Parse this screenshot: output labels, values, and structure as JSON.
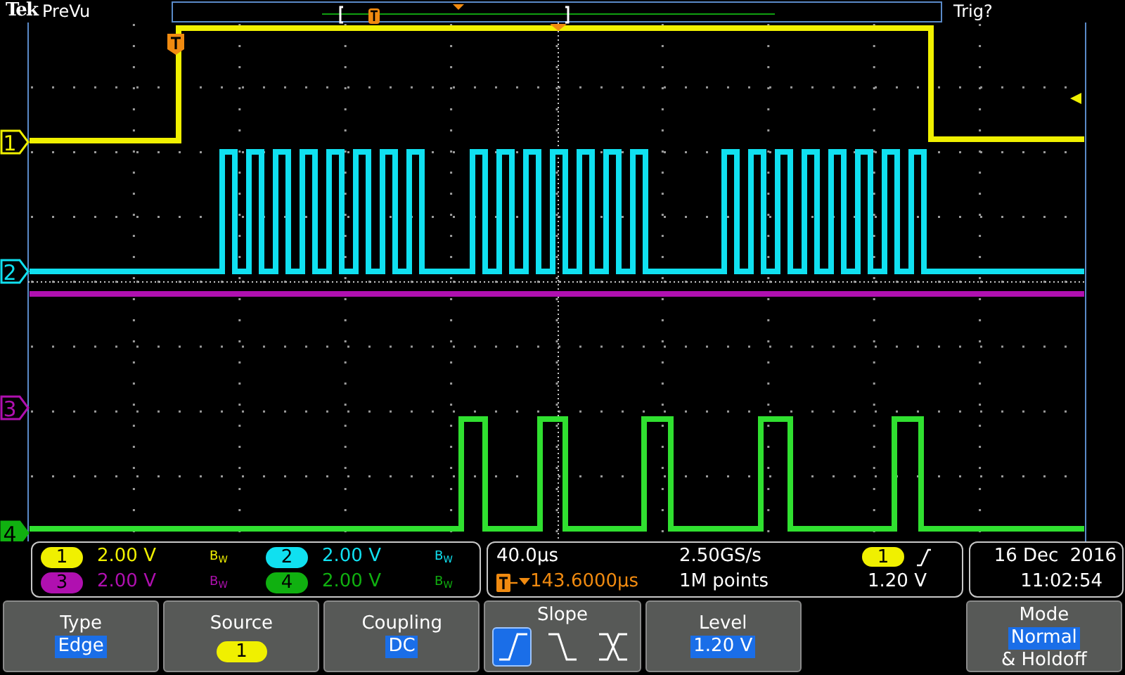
{
  "header": {
    "brand": "Tek",
    "status": "PreVu",
    "trigger_status": "Trig?"
  },
  "channels": [
    {
      "marker_label": "1",
      "badge_label": "1",
      "scale": "2.00 V",
      "bandwidth": "B$_{W}$",
      "color": "#f0f000",
      "selected": false
    },
    {
      "marker_label": "2",
      "badge_label": "2",
      "scale": "2.00 V",
      "bandwidth": "B$_{W}$",
      "color": "#10e0f0",
      "selected": false
    },
    {
      "marker_label": "3",
      "badge_label": "3",
      "scale": "2.00 V",
      "bandwidth": "B$_{W}$",
      "color": "#b010b0",
      "selected": false
    },
    {
      "marker_label": "4",
      "badge_label": "4",
      "scale": "2.00 V",
      "bandwidth": "B$_{W}$",
      "color": "#10b010",
      "selected": true
    }
  ],
  "timebase": {
    "scale": "40.0µs",
    "sample_rate": "2.50GS/s",
    "trigger_position": "143.6000µs",
    "record_length": "1M points",
    "trigger_source": "1",
    "trigger_level": "1.20 V"
  },
  "clock": {
    "date": "16 Dec  2016",
    "time": "11:02:54"
  },
  "softkeys": [
    {
      "kind": "text",
      "label": "Type",
      "value": "Edge"
    },
    {
      "kind": "channel",
      "label": "Source",
      "value": "1"
    },
    {
      "kind": "text",
      "label": "Coupling",
      "value": "DC"
    },
    {
      "kind": "slope",
      "label": "Slope",
      "options": [
        {
          "kind": "rising",
          "selected": true
        },
        {
          "kind": "falling",
          "selected": false
        },
        {
          "kind": "either",
          "selected": false
        }
      ]
    },
    {
      "kind": "text",
      "label": "Level",
      "value": "1.20 V"
    },
    {
      "kind": "blank"
    },
    {
      "kind": "text",
      "label": "Mode",
      "value": "Normal",
      "note": "& Holdoff"
    }
  ]
}
